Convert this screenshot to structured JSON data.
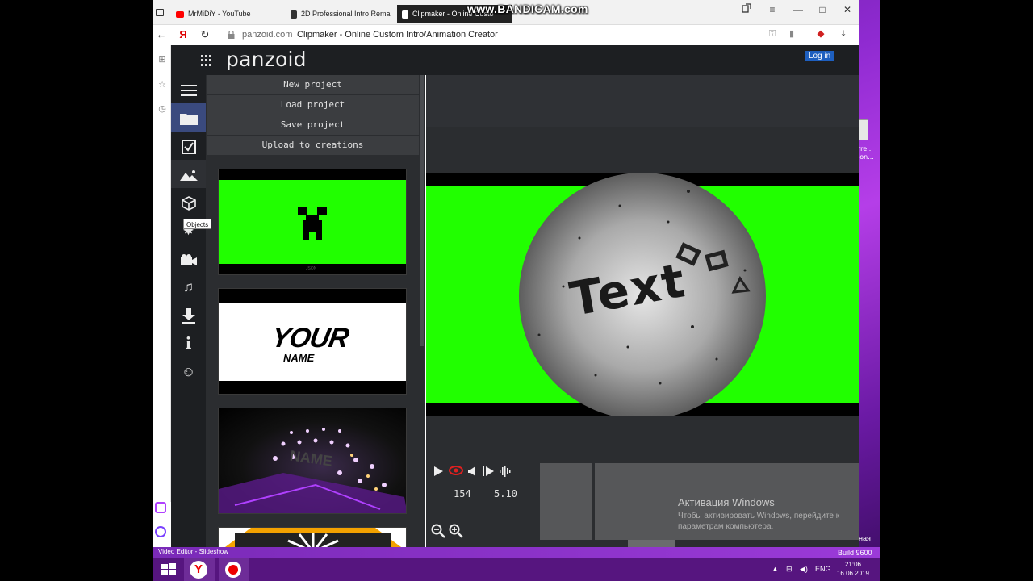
{
  "overlay": {
    "recorder_watermark": "www.BANDICAM.com"
  },
  "browser": {
    "tabs": [
      {
        "label": "MrMiDiY - YouTube",
        "favicon_color": "#ff0000"
      },
      {
        "label": "2D Professional Intro Rema",
        "favicon_color": "#222222"
      },
      {
        "label": "Clipmaker - Online Custo",
        "favicon_color": "#ffffff"
      }
    ],
    "window_controls": {
      "pin": "pin-icon",
      "menu": "≡",
      "minimize": "—",
      "maximize": "□",
      "close": "✕"
    },
    "address": {
      "domain": "panzoid.com",
      "title": "Clipmaker - Online Custom Intro/Animation Creator",
      "yandex_letter": "Я"
    }
  },
  "app": {
    "logo": "panzoid",
    "login_label": "Log in",
    "tool_tooltip": "Objects",
    "toolbar": [
      {
        "name": "menu",
        "icon": "hamburger-icon"
      },
      {
        "name": "projects",
        "icon": "folder-icon"
      },
      {
        "name": "checklist",
        "icon": "checkbox-icon"
      },
      {
        "name": "backgrounds",
        "icon": "landscape-icon"
      },
      {
        "name": "objects",
        "icon": "cube-icon"
      },
      {
        "name": "effects",
        "icon": "burst-icon"
      },
      {
        "name": "camera",
        "icon": "camera-icon"
      },
      {
        "name": "audio",
        "icon": "music-icon"
      },
      {
        "name": "download",
        "icon": "download-icon"
      },
      {
        "name": "info",
        "icon": "info-icon"
      },
      {
        "name": "emoji",
        "icon": "smiley-icon"
      }
    ],
    "project_menu": [
      "New project",
      "Load project",
      "Save project",
      "Upload to creations"
    ],
    "templates": [
      {
        "caption": "JSON"
      },
      {
        "title_top": "YOUR",
        "title_bottom": "NAME"
      },
      {
        "text": "NAME"
      },
      {}
    ],
    "preview": {
      "text": "Text",
      "bg_color": "#21ff00"
    },
    "playback": {
      "frame": "154",
      "time": "5.10"
    },
    "activation": {
      "title": "Активация Windows",
      "subtitle": "Чтобы активировать Windows, перейдите к параметрам компьютера."
    }
  },
  "desktop": {
    "icon_label": "rre... lon...",
    "bottom_right_text": "ная",
    "build": "Build 9600",
    "strip_left": "Video Editor  - Slideshow"
  },
  "taskbar": {
    "lang": "ENG",
    "time": "21:06",
    "date": "16.06.2019",
    "yandex_letter": "Y"
  }
}
